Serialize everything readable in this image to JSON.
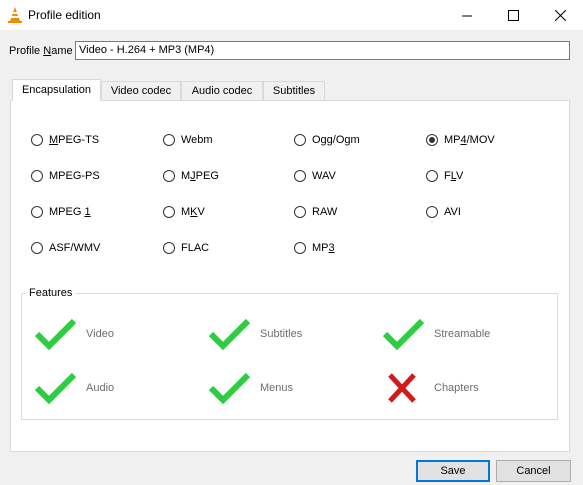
{
  "window": {
    "title": "Profile edition",
    "icon": "vlc-cone-icon",
    "controls": [
      "minimize-icon",
      "maximize-icon",
      "close-icon"
    ]
  },
  "profile": {
    "label_prefix": "Profile ",
    "label_accel": "N",
    "label_suffix": "ame",
    "value": "Video - H.264 + MP3 (MP4)"
  },
  "tabs": [
    {
      "label": "Encapsulation",
      "active": true
    },
    {
      "label": "Video codec",
      "active": false
    },
    {
      "label": "Audio codec",
      "active": false
    },
    {
      "label": "Subtitles",
      "active": false
    }
  ],
  "formats": [
    {
      "pre": "",
      "acc": "M",
      "post": "PEG-TS",
      "selected": false
    },
    {
      "pre": "",
      "acc": "",
      "post": "Webm",
      "selected": false
    },
    {
      "pre": "",
      "acc": "",
      "post": "Ogg/Ogm",
      "selected": false
    },
    {
      "pre": "MP",
      "acc": "4",
      "post": "/MOV",
      "selected": true
    },
    {
      "pre": "",
      "acc": "",
      "post": "MPEG-PS",
      "selected": false
    },
    {
      "pre": "M",
      "acc": "J",
      "post": "PEG",
      "selected": false
    },
    {
      "pre": "",
      "acc": "",
      "post": "WAV",
      "selected": false
    },
    {
      "pre": "F",
      "acc": "L",
      "post": "V",
      "selected": false
    },
    {
      "pre": "MPEG ",
      "acc": "1",
      "post": "",
      "selected": false
    },
    {
      "pre": "M",
      "acc": "K",
      "post": "V",
      "selected": false
    },
    {
      "pre": "",
      "acc": "",
      "post": "RAW",
      "selected": false
    },
    {
      "pre": "",
      "acc": "",
      "post": "AVI",
      "selected": false
    },
    {
      "pre": "",
      "acc": "",
      "post": "ASF/WMV",
      "selected": false
    },
    {
      "pre": "",
      "acc": "",
      "post": "FLAC",
      "selected": false
    },
    {
      "pre": "MP",
      "acc": "3",
      "post": "",
      "selected": false
    }
  ],
  "features": {
    "title": "Features",
    "items": [
      {
        "label": "Video",
        "supported": true,
        "icon": "check-icon"
      },
      {
        "label": "Subtitles",
        "supported": true,
        "icon": "check-icon"
      },
      {
        "label": "Streamable",
        "supported": true,
        "icon": "check-icon"
      },
      {
        "label": "Audio",
        "supported": true,
        "icon": "check-icon"
      },
      {
        "label": "Menus",
        "supported": true,
        "icon": "check-icon"
      },
      {
        "label": "Chapters",
        "supported": false,
        "icon": "cross-icon"
      }
    ]
  },
  "buttons": {
    "save": "Save",
    "cancel": "Cancel"
  },
  "colors": {
    "check": "#2ecc40",
    "cross": "#d11a1a",
    "disabled_text": "#6d6d6d",
    "accent": "#0078d7"
  }
}
